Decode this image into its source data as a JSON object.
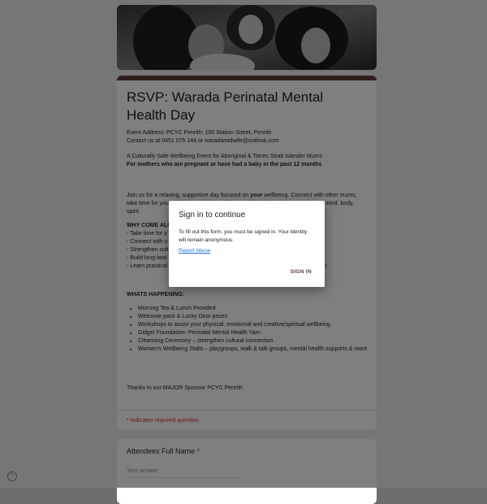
{
  "form": {
    "title": "RSVP: Warada Perinatal Mental Health Day",
    "address": "Event Address: PCYC Penrith: 100 Station Street, Penrith",
    "contact": "Contact us at 0451 075 144 or waradamidwife@outlook.com",
    "subtitle": "A Culturally Safe Wellbeing Event for Aboriginal & Torres Strait Islander Mums",
    "audience": "For mothers who are pregnant or have had a baby in the past 12 months",
    "intro_start": "Join us for a relaxing, supportive day focused on ",
    "intro_bold": "your",
    "intro_end": " wellbeing. Connect with other mums, take time for yourself, and enjoy culturally grounded activities that nurture your mind, body, spirit.",
    "why_heading": "WHY COME ALO",
    "why_items": [
      "- Take time for y",
      "- Connect with o",
      "- Strengthen cult",
      "- Build long-lasti",
      "- Learn practical"
    ],
    "why_tail": "n",
    "happening_heading": "WHATS HAPPENING:",
    "happening_items": [
      "Morning Tea & Lunch Provided",
      "Welcome pack & Lucky Door prizes",
      "Workshops to assist your physical, emotional and creative/spiritual wellbeing.",
      "Gidget Foundation- Perinatal Mental Health Yarn",
      "Cleansing Ceremony – strengthen cultural connection",
      "Women's Wellbeing Stalls – playgroups, walk & talk groups, mental health supports & more"
    ],
    "thanks": "Thanks to our MAJOR Sponsor PCYC Penrith",
    "required_note": "* Indicates required question"
  },
  "question": {
    "label": "Attendees Full Name",
    "required_mark": "*",
    "placeholder": "Your answer"
  },
  "dialog": {
    "title": "Sign in to continue",
    "body": "To fill out this form, you must be signed in. Your identity will remain anonymous.",
    "link": "Report Abuse",
    "button": "SIGN IN"
  },
  "help_icon": "?",
  "colors": {
    "accent": "#5e3b3b",
    "link": "#1a73e8",
    "required": "#d93025"
  }
}
